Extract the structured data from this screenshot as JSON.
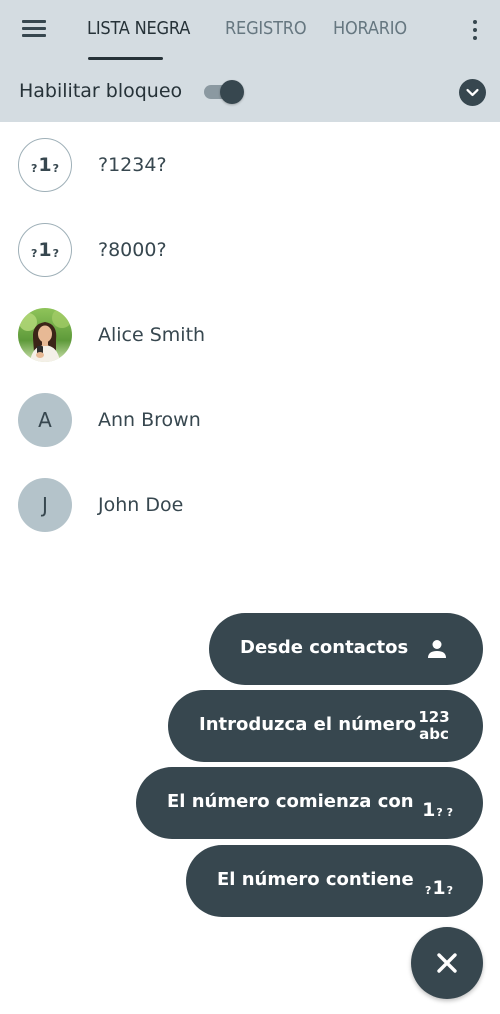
{
  "header": {
    "menu_icon": "hamburger-menu-icon",
    "tabs": [
      {
        "label": "LISTA NEGRA",
        "active": true
      },
      {
        "label": "REGISTRO",
        "active": false
      },
      {
        "label": "HORARIO",
        "active": false
      }
    ],
    "more_icon": "more-vert-icon",
    "toggle": {
      "label": "Habilitar bloqueo",
      "enabled": true
    },
    "collapse_icon": "chevron-down-icon"
  },
  "blacklist": [
    {
      "name": "?1234?",
      "avatar_type": "pattern",
      "avatar_glyph": {
        "left": "?",
        "center": "1",
        "right": "?"
      }
    },
    {
      "name": "?8000?",
      "avatar_type": "pattern",
      "avatar_glyph": {
        "left": "?",
        "center": "1",
        "right": "?"
      }
    },
    {
      "name": "Alice Smith",
      "avatar_type": "photo"
    },
    {
      "name": "Ann Brown",
      "avatar_type": "letter",
      "avatar_letter": "A"
    },
    {
      "name": "John Doe",
      "avatar_type": "letter",
      "avatar_letter": "J"
    }
  ],
  "fab_menu": {
    "actions": [
      {
        "label": "Desde contactos",
        "icon": "person-icon"
      },
      {
        "label": "Introduzca el número",
        "icon": "numbers-icon",
        "icon_text": [
          "123",
          "abc"
        ]
      },
      {
        "label": "El número comienza con",
        "icon": "starts-with-icon",
        "icon_glyph": {
          "center": "1",
          "right": "? ?"
        }
      },
      {
        "label": "El número contiene",
        "icon": "contains-icon",
        "icon_glyph": {
          "left": "?",
          "center": "1",
          "right": "?"
        }
      }
    ],
    "close_icon": "close-icon"
  },
  "colors": {
    "header_bg": "#d4dce1",
    "primary_dark": "#37474f",
    "letter_avatar_bg": "#b4c3ca",
    "background": "#ffffff"
  }
}
